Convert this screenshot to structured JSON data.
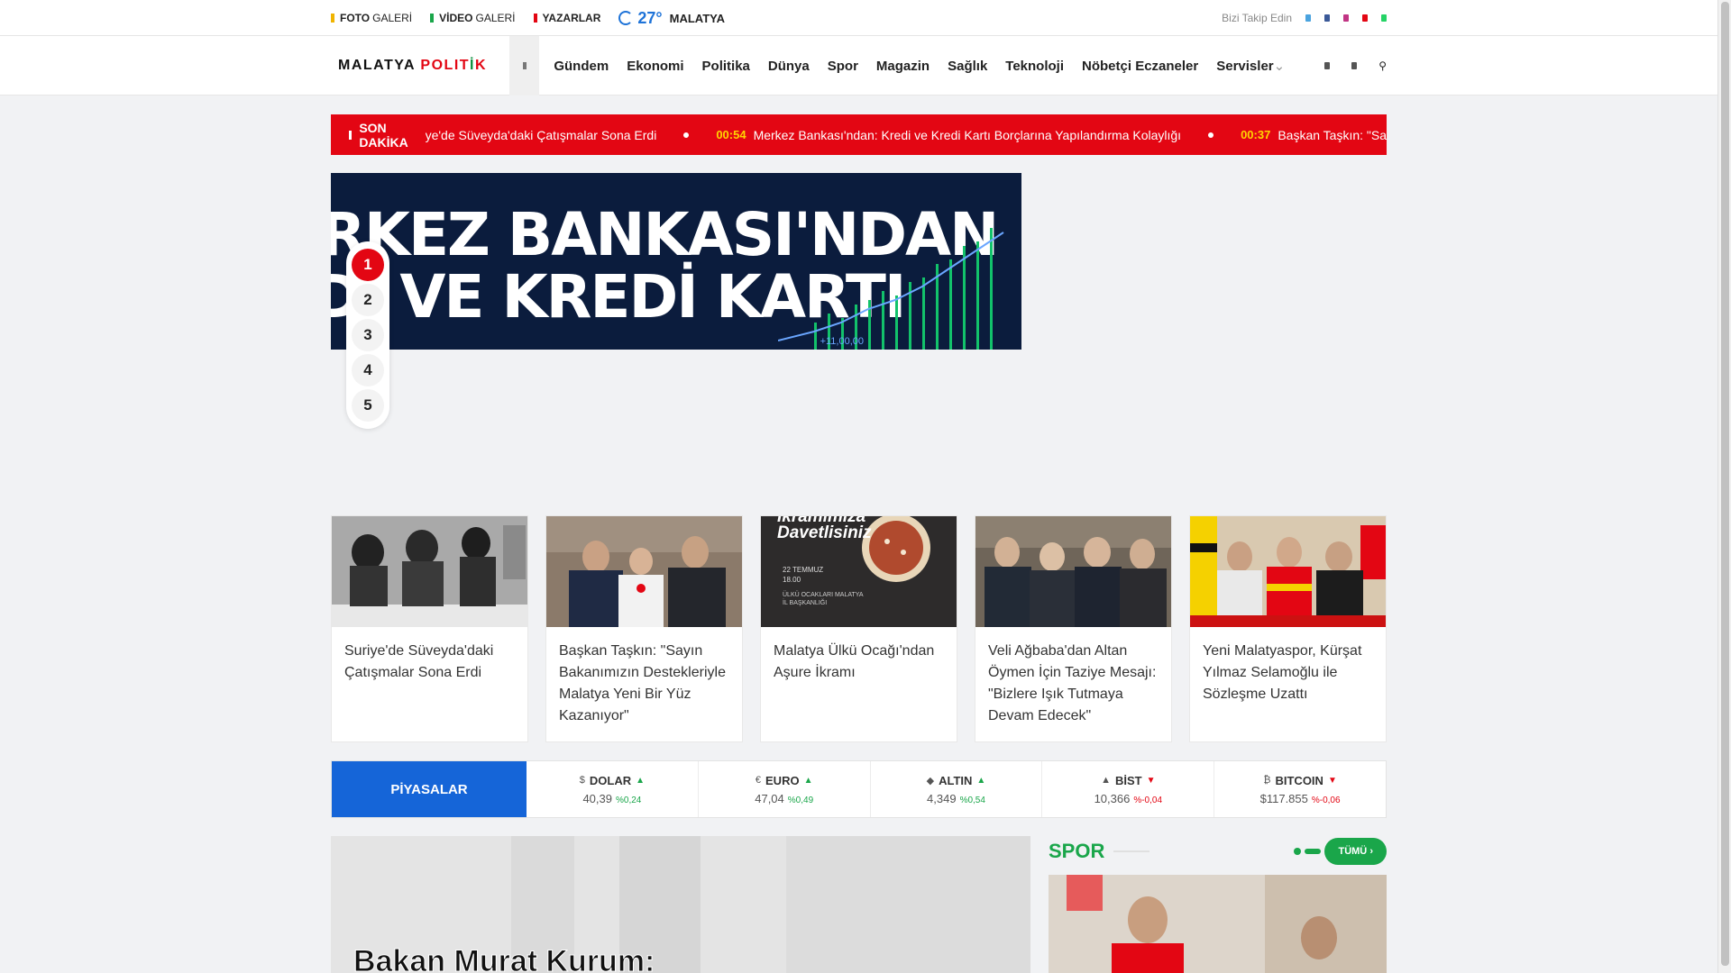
{
  "topbar": {
    "foto_bold": "FOTO",
    "foto_thin": "GALERİ",
    "video_bold": "VİDEO",
    "video_thin": "GALERİ",
    "yazarlar": "YAZARLAR",
    "temperature": "27°",
    "city": "MALATYA",
    "follow_text": "Bizi Takip Edin",
    "social_icons": [
      "twitter-icon",
      "facebook-icon",
      "instagram-icon",
      "youtube-icon",
      "whatsapp-icon"
    ]
  },
  "header": {
    "logo_part1": "MALATYA",
    "logo_part2": "POLIT",
    "logo_part3": "İ",
    "logo_part4": "K",
    "nav": [
      "Gündem",
      "Ekonomi",
      "Politika",
      "Dünya",
      "Spor",
      "Magazin",
      "Sağlık",
      "Teknoloji",
      "Nöbetçi Eczaneler",
      "Servisler"
    ],
    "nav_caret": "⌄"
  },
  "breaking": {
    "label": "SON DAKİKA",
    "items": [
      {
        "time": "",
        "text": "Suriye'de Süveyda'daki Çatışmalar Sona Erdi"
      },
      {
        "time": "00:54",
        "text": "Merkez Bankası'ndan: Kredi ve Kredi Kartı Borçlarına Yapılandırma Kolaylığı"
      },
      {
        "time": "00:37",
        "text": "Başkan Taşkın: \"Sa"
      }
    ]
  },
  "hero": {
    "line1": "RKEZ BANKASI'NDAN",
    "line2": "Dİ VE KREDİ KARTI",
    "figure": "+11,00,00"
  },
  "slider_numbers": [
    "1",
    "2",
    "3",
    "4",
    "5"
  ],
  "cards": [
    {
      "title": "Suriye'de Süveyda'daki Çatışmalar Sona Erdi"
    },
    {
      "title": "Başkan Taşkın: \"Sayın Bakanımızın Destekleriyle Malatya Yeni Bir Yüz Kazanıyor\""
    },
    {
      "title": "Malatya Ülkü Ocağı'ndan Aşure İkramı",
      "img_text1": "İkramımıza",
      "img_text2": "Davetlisiniz",
      "img_date1": "22 TEMMUZ",
      "img_date2": "18.00",
      "img_org1": "ÜLKÜ OCAKLARI MALATYA",
      "img_org2": "İL BAŞKANLIĞI"
    },
    {
      "title": "Veli Ağbaba'dan Altan Öymen İçin Taziye Mesajı: \"Bizlere Işık Tutmaya Devam Edecek\""
    },
    {
      "title": "Yeni Malatyaspor, Kürşat Yılmaz Selamoğlu ile Sözleşme Uzattı"
    }
  ],
  "markets": {
    "label": "PİYASALAR",
    "items": [
      {
        "symbol": "$",
        "name": "DOLAR",
        "value": "40,39",
        "change": "%0,24",
        "direction": "up"
      },
      {
        "symbol": "€",
        "name": "EURO",
        "value": "47,04",
        "change": "%0,49",
        "direction": "up"
      },
      {
        "symbol": "◆",
        "name": "ALTIN",
        "value": "4,349",
        "change": "%0,54",
        "direction": "up"
      },
      {
        "symbol": "▲",
        "name": "BİST",
        "value": "10,366",
        "change": "%-0,04",
        "direction": "down"
      },
      {
        "symbol": "₿",
        "name": "BITCOIN",
        "value": "$117.855",
        "change": "%-0,06",
        "direction": "down"
      }
    ]
  },
  "big_news": {
    "title": "Bakan Murat Kurum:"
  },
  "spor": {
    "title": "SPOR",
    "button": "TÜMÜ"
  },
  "colors": {
    "brand_red": "#e30613",
    "accent_blue": "#1565d8",
    "green": "#1aa64a"
  }
}
